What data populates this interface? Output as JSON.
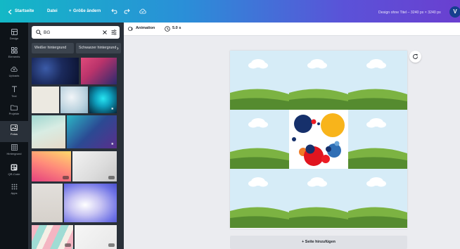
{
  "topbar": {
    "home_label": "Startseite",
    "file_label": "Datei",
    "resize_label": "Größe ändern",
    "resize_prefix": "+",
    "doc_title": "Design ohne Titel – 3240 px × 3240 px",
    "avatar_letter": "V",
    "background_colors": [
      "#13b8c6",
      "#2a8fd8",
      "#5b52d8",
      "#6a3fd0"
    ]
  },
  "rail": {
    "items": [
      {
        "label": "Design",
        "icon": "layout-icon"
      },
      {
        "label": "Elements",
        "icon": "shapes-icon"
      },
      {
        "label": "Uploads",
        "icon": "upload-cloud-icon"
      },
      {
        "label": "Text",
        "icon": "text-icon"
      },
      {
        "label": "Projekte",
        "icon": "folder-icon"
      },
      {
        "label": "Fotos",
        "icon": "photo-icon",
        "active": true
      },
      {
        "label": "Hintergrund",
        "icon": "pattern-icon"
      },
      {
        "label": "QR-Code",
        "icon": "qr-code-icon"
      },
      {
        "label": "Apps",
        "icon": "apps-grid-icon"
      }
    ]
  },
  "panel": {
    "search_value": "BG",
    "chips": [
      "Weißer hintergrund",
      "Schwarzer hintergrund"
    ],
    "chip_arrow": "›"
  },
  "subbar": {
    "animation_label": "Animation",
    "duration_label": "5.0 s"
  },
  "canvas": {
    "add_page_label": "+ Seite hinzufügen",
    "accent_color": "#8b3dff"
  }
}
